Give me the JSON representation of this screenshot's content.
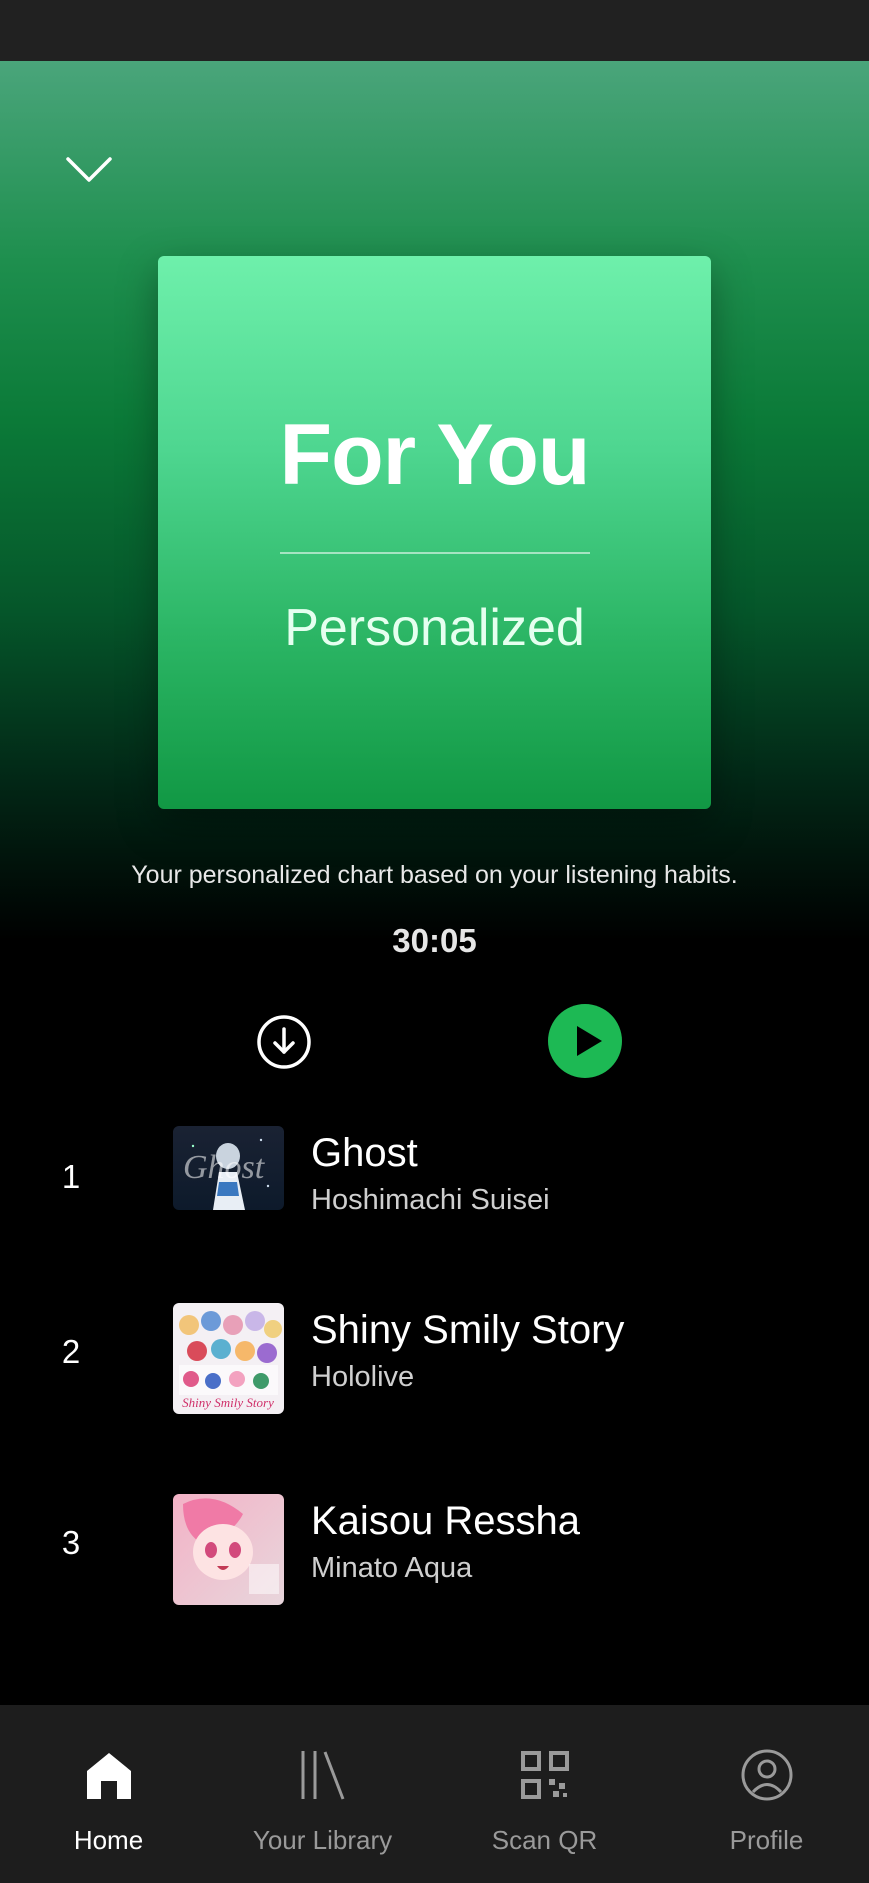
{
  "playlist": {
    "cover_title": "For You",
    "cover_subtitle": "Personalized",
    "description": "Your personalized chart based on your listening habits.",
    "duration": "30:05"
  },
  "colors": {
    "accent": "#1db954",
    "header_top": "#4aa57b",
    "cover_top": "#6ef0ab",
    "cover_bottom": "#119844"
  },
  "icons": {
    "collapse": "chevron-down-icon",
    "download": "download-circle-icon",
    "play": "play-icon"
  },
  "tracks": [
    {
      "rank": "1",
      "title": "Ghost",
      "artist": "Hoshimachi Suisei",
      "art_text": "Ghost"
    },
    {
      "rank": "2",
      "title": "Shiny Smily Story",
      "artist": "Hololive",
      "art_text": "Shiny Smily Story"
    },
    {
      "rank": "3",
      "title": "Kaisou Ressha",
      "artist": "Minato Aqua",
      "art_text": ""
    }
  ],
  "nav": [
    {
      "label": "Home",
      "icon": "home-icon",
      "active": true
    },
    {
      "label": "Your Library",
      "icon": "library-icon",
      "active": false
    },
    {
      "label": "Scan QR",
      "icon": "qr-code-icon",
      "active": false
    },
    {
      "label": "Profile",
      "icon": "profile-icon",
      "active": false
    }
  ]
}
